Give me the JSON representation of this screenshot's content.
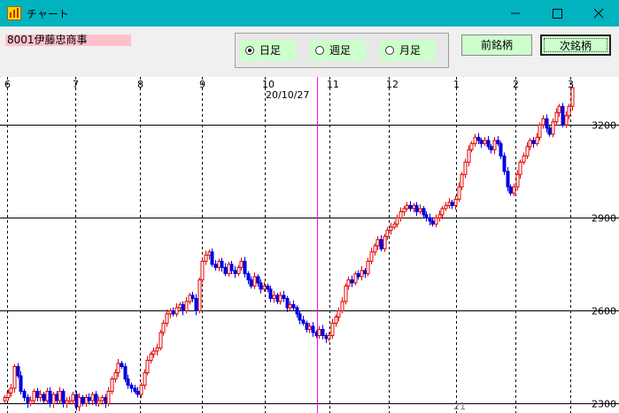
{
  "window": {
    "title": "チャート"
  },
  "toolbar": {
    "stock_label": "8001伊藤忠商事",
    "period_options": [
      {
        "label": "日足",
        "selected": true
      },
      {
        "label": "週足",
        "selected": false
      },
      {
        "label": "月足",
        "selected": false
      }
    ],
    "prev_button": "前銘柄",
    "next_button": "次銘柄"
  },
  "colors": {
    "titlebar": "#00b3bf",
    "up_candle": "#e00000",
    "down_candle": "#0000e0",
    "cursor_line": "#ff00ff",
    "button_bg": "#ccffcc"
  },
  "chart_data": {
    "type": "candlestick",
    "y_ticks": [
      3200,
      2900,
      2600,
      2300
    ],
    "ylim": [
      2270,
      3355
    ],
    "month_labels": [
      "6",
      "7",
      "8",
      "9",
      "10",
      "11",
      "12",
      "1",
      "2",
      "3"
    ],
    "cursor_date": "20/10/27",
    "bottom_label": "21",
    "grid": "horizontal solid at y ticks, vertical dashed at month starts",
    "closes": [
      2320,
      2335,
      2350,
      2420,
      2390,
      2340,
      2320,
      2300,
      2310,
      2340,
      2320,
      2330,
      2310,
      2340,
      2300,
      2330,
      2310,
      2340,
      2300,
      2310,
      2310,
      2330,
      2290,
      2320,
      2300,
      2320,
      2310,
      2330,
      2300,
      2310,
      2320,
      2300,
      2340,
      2380,
      2400,
      2430,
      2420,
      2380,
      2360,
      2350,
      2340,
      2330,
      2360,
      2400,
      2440,
      2460,
      2470,
      2480,
      2530,
      2560,
      2590,
      2600,
      2590,
      2610,
      2620,
      2600,
      2630,
      2650,
      2640,
      2600,
      2700,
      2760,
      2780,
      2790,
      2750,
      2740,
      2760,
      2740,
      2720,
      2750,
      2730,
      2720,
      2740,
      2760,
      2720,
      2700,
      2680,
      2710,
      2690,
      2670,
      2680,
      2670,
      2640,
      2650,
      2630,
      2650,
      2640,
      2610,
      2620,
      2610,
      2590,
      2570,
      2560,
      2540,
      2550,
      2530,
      2520,
      2540,
      2520,
      2510,
      2520,
      2560,
      2580,
      2600,
      2630,
      2680,
      2700,
      2690,
      2720,
      2710,
      2730,
      2720,
      2760,
      2790,
      2810,
      2830,
      2800,
      2840,
      2860,
      2870,
      2880,
      2900,
      2920,
      2930,
      2940,
      2930,
      2940,
      2920,
      2930,
      2910,
      2900,
      2890,
      2880,
      2900,
      2910,
      2930,
      2940,
      2950,
      2940,
      2960,
      3000,
      3040,
      3080,
      3120,
      3140,
      3160,
      3150,
      3140,
      3150,
      3130,
      3120,
      3150,
      3140,
      3100,
      3050,
      3000,
      2980,
      3000,
      3040,
      3080,
      3100,
      3130,
      3150,
      3140,
      3160,
      3200,
      3220,
      3190,
      3170,
      3210,
      3240,
      3260,
      3200,
      3230,
      3260,
      3320
    ]
  }
}
